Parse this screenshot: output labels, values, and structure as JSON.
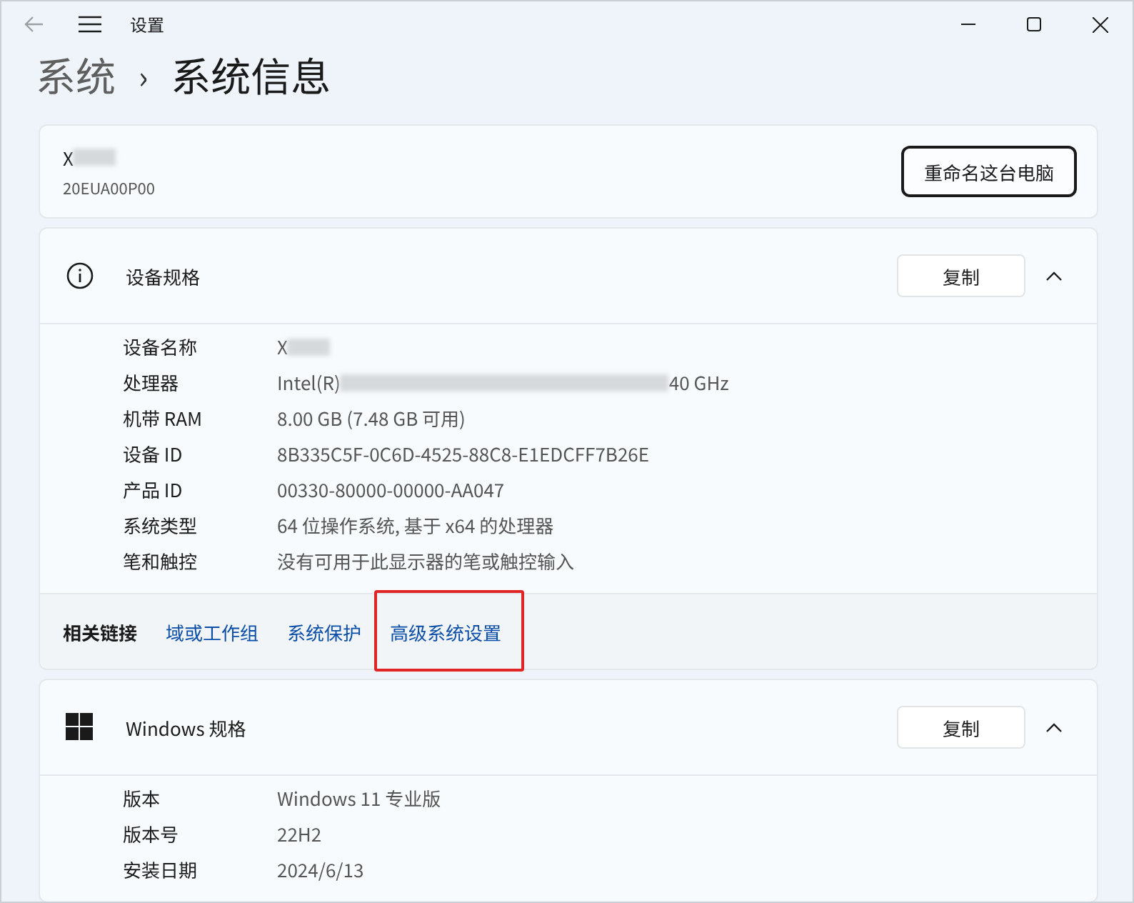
{
  "window": {
    "title": "设置"
  },
  "breadcrumb": {
    "parent": "系统",
    "separator": "›",
    "current": "系统信息"
  },
  "device": {
    "name": "X",
    "name_redacted": true,
    "model": "20EUA00P00",
    "rename_button": "重命名这台电脑"
  },
  "sections": [
    {
      "kind": "info",
      "title": "设备规格",
      "copy_button": "复制",
      "expanded": true,
      "rows": [
        {
          "label": "设备名称",
          "value": "X",
          "redacted": true
        },
        {
          "label": "处理器",
          "value": "Intel(R)",
          "redacted": true,
          "value_tail": "40 GHz"
        },
        {
          "label": "机带 RAM",
          "value": "8.00 GB (7.48 GB 可用)"
        },
        {
          "label": "设备 ID",
          "value": "8B335C5F-0C6D-4525-88C8-E1EDCFF7B26E"
        },
        {
          "label": "产品 ID",
          "value": "00330-80000-00000-AA047"
        },
        {
          "label": "系统类型",
          "value": "64 位操作系统, 基于 x64 的处理器"
        },
        {
          "label": "笔和触控",
          "value": "没有可用于此显示器的笔或触控输入"
        }
      ],
      "related": {
        "label": "相关链接",
        "links": [
          {
            "text": "域或工作组",
            "highlighted": false
          },
          {
            "text": "系统保护",
            "highlighted": false
          },
          {
            "text": "高级系统设置",
            "highlighted": true
          }
        ]
      }
    },
    {
      "kind": "windows",
      "title": "Windows 规格",
      "copy_button": "复制",
      "expanded": true,
      "rows": [
        {
          "label": "版本",
          "value": "Windows 11 专业版"
        },
        {
          "label": "版本号",
          "value": "22H2"
        },
        {
          "label": "安装日期",
          "value": "2024/6/13"
        }
      ]
    }
  ]
}
